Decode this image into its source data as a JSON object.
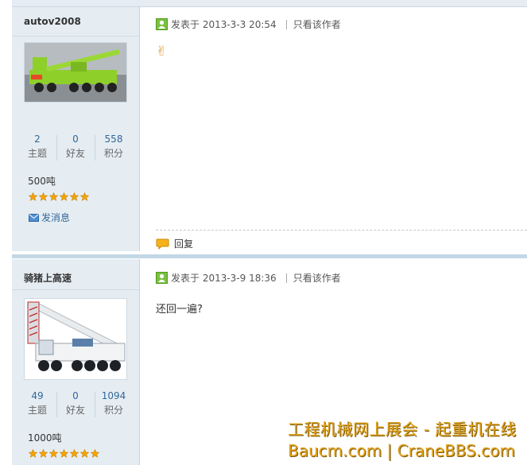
{
  "posts": [
    {
      "author": "autov2008",
      "stats": [
        {
          "num": "2",
          "label": "主题"
        },
        {
          "num": "0",
          "label": "好友"
        },
        {
          "num": "558",
          "label": "积分"
        }
      ],
      "rank": "500吨",
      "star_count": 6,
      "send_message": "发消息",
      "posted_label": "发表于 2013-3-3 20:54",
      "only_author": "只看该作者",
      "content": "✌",
      "reply_label": "回复"
    },
    {
      "author": "骑猪上高速",
      "stats": [
        {
          "num": "49",
          "label": "主题"
        },
        {
          "num": "0",
          "label": "好友"
        },
        {
          "num": "1094",
          "label": "积分"
        }
      ],
      "rank": "1000吨",
      "star_count": 7,
      "posted_label": "发表于 2013-3-9 18:36",
      "only_author": "只看该作者",
      "content": "还回一遍?"
    }
  ],
  "watermark": {
    "line1": "工程机械网上展会 - 起重机在线",
    "line2": "Baucm.com | CraneBBS.com"
  },
  "colors": {
    "sidebar_bg": "#e5edf2",
    "link": "#336699",
    "star": "#f5a500",
    "crane1": "#8ecf2a",
    "crane2": "#e9ecef",
    "watermark": "#e2a21c"
  }
}
